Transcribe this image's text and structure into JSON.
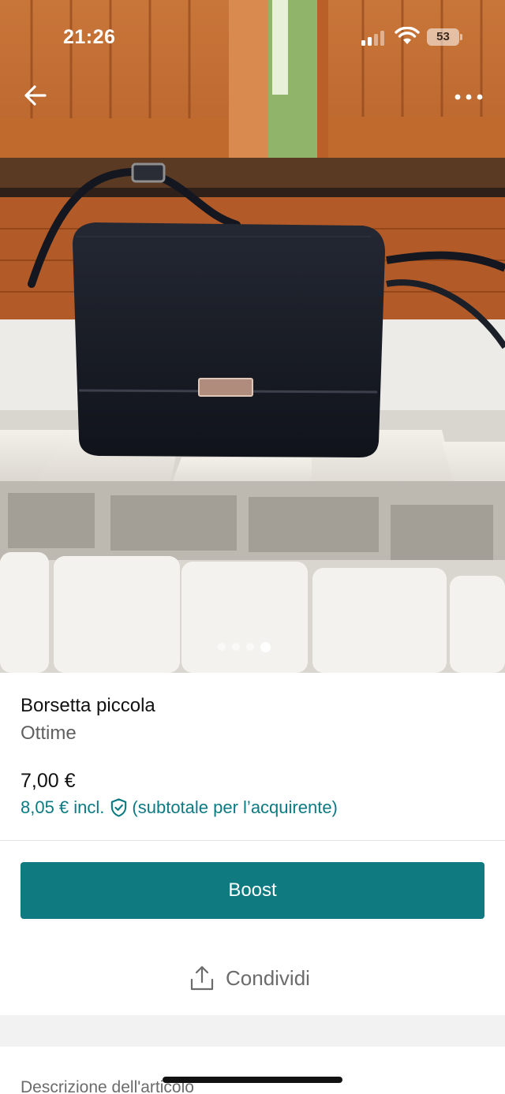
{
  "status_bar": {
    "time": "21:26",
    "battery": "53",
    "icons": [
      "cellular-signal-icon",
      "wifi-icon",
      "battery-icon"
    ]
  },
  "header": {
    "back_icon": "arrow-left-icon",
    "more_icon": "more-horizontal-icon"
  },
  "gallery": {
    "image_count": 4,
    "active_index": 4,
    "photo_subject": "black crossbody bag on radiator"
  },
  "item": {
    "title": "Borsetta piccola",
    "condition": "Ottime",
    "price": "7,00 €",
    "buyer_price": "8,05 € incl.",
    "buyer_price_note": "(subtotale per l’acquirente)",
    "protection_icon": "shield-check-icon"
  },
  "actions": {
    "boost_label": "Boost",
    "share_label": "Condividi",
    "share_icon": "share-icon"
  },
  "description": {
    "heading": "Descrizione dell'articolo"
  },
  "colors": {
    "accent": "#0f7a80",
    "accent_text": "#0c7a83",
    "muted_text": "#6b6b6b"
  }
}
